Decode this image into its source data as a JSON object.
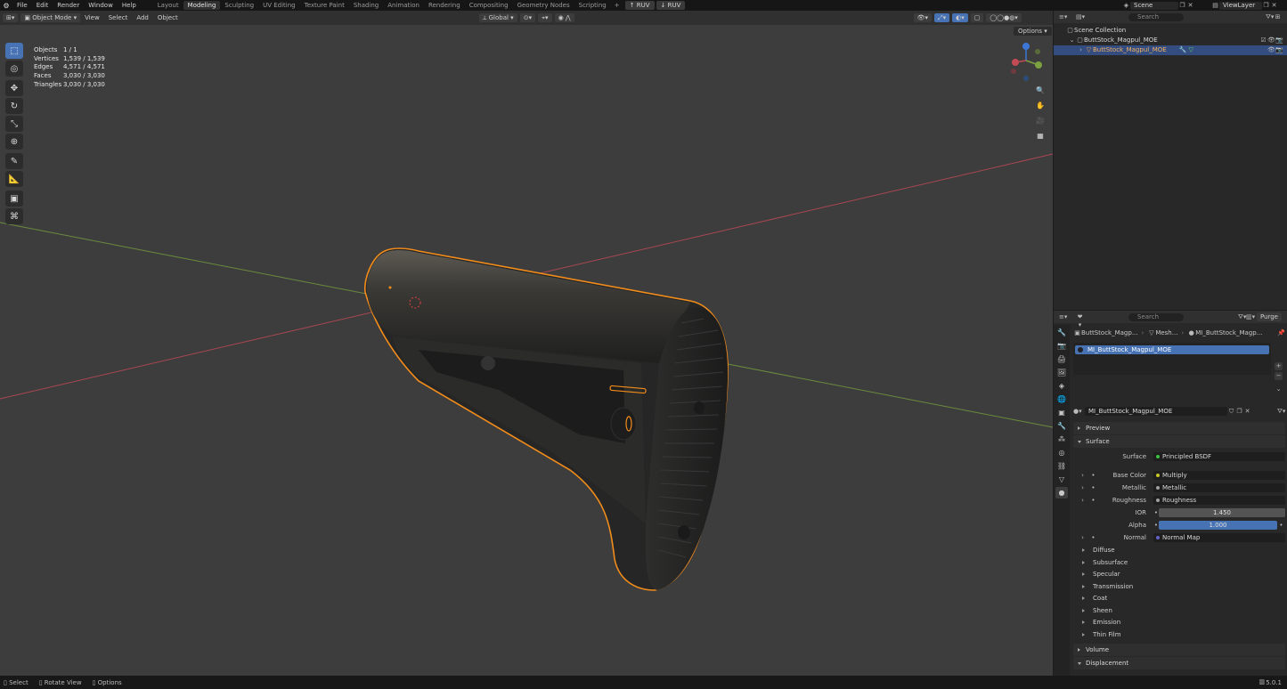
{
  "topbar": {
    "menus": [
      "File",
      "Edit",
      "Render",
      "Window",
      "Help"
    ],
    "workspaces": [
      "Layout",
      "Modeling",
      "Sculpting",
      "UV Editing",
      "Texture Paint",
      "Shading",
      "Animation",
      "Rendering",
      "Compositing",
      "Geometry Nodes",
      "Scripting"
    ],
    "active_workspace": "Modeling",
    "addon_buttons": [
      "RUV",
      "RUV"
    ],
    "scene": "Scene",
    "view_layer": "ViewLayer"
  },
  "viewport_header": {
    "mode": "Object Mode",
    "menus": [
      "View",
      "Select",
      "Add",
      "Object"
    ],
    "transform_orientation": "Global",
    "options": "Options"
  },
  "stats": [
    {
      "label": "Objects",
      "value": "1 / 1"
    },
    {
      "label": "Vertices",
      "value": "1,539 / 1,539"
    },
    {
      "label": "Edges",
      "value": "4,571 / 4,571"
    },
    {
      "label": "Faces",
      "value": "3,030 / 3,030"
    },
    {
      "label": "Triangles",
      "value": "3,030 / 3,030"
    }
  ],
  "outliner": {
    "search_placeholder": "Search",
    "root": "Scene Collection",
    "collection": "ButtStock_Magpul_MOE",
    "object": "ButtStock_Magpul_MOE"
  },
  "properties": {
    "search_placeholder": "Search",
    "purge": "Purge",
    "breadcrumb": [
      "ButtStock_Magp...",
      "Mesh...",
      "MI_ButtStock_Magp..."
    ],
    "slot": "MI_ButtStock_Magpul_MOE",
    "material": "MI_ButtStock_Magpul_MOE",
    "sections": {
      "preview": "Preview",
      "surface": "Surface",
      "volume": "Volume",
      "displacement": "Displacement"
    },
    "surface_rows": [
      {
        "label": "Surface",
        "value": "Principled BSDF",
        "dot": "#3fbf3f"
      },
      {
        "label": "Base Color",
        "value": "Multiply",
        "dot": "#c7c729"
      },
      {
        "label": "Metallic",
        "value": "Metallic",
        "dot": "#a1a1a1"
      },
      {
        "label": "Roughness",
        "value": "Roughness",
        "dot": "#a1a1a1"
      }
    ],
    "ior": {
      "label": "IOR",
      "value": "1.450"
    },
    "alpha": {
      "label": "Alpha",
      "value": "1.000"
    },
    "normal": {
      "label": "Normal",
      "value": "Normal Map",
      "dot": "#6363c7"
    },
    "subpanels": [
      "Diffuse",
      "Subsurface",
      "Specular",
      "Transmission",
      "Coat",
      "Sheen",
      "Emission",
      "Thin Film"
    ]
  },
  "statusbar": {
    "items": [
      "Select",
      "Rotate View",
      "Options"
    ],
    "version": "5.0.1"
  },
  "colors": {
    "accent": "#4772b3",
    "selection_outline": "#f28c1b",
    "axis_x": "#c44b55",
    "axis_y": "#7ca040"
  }
}
